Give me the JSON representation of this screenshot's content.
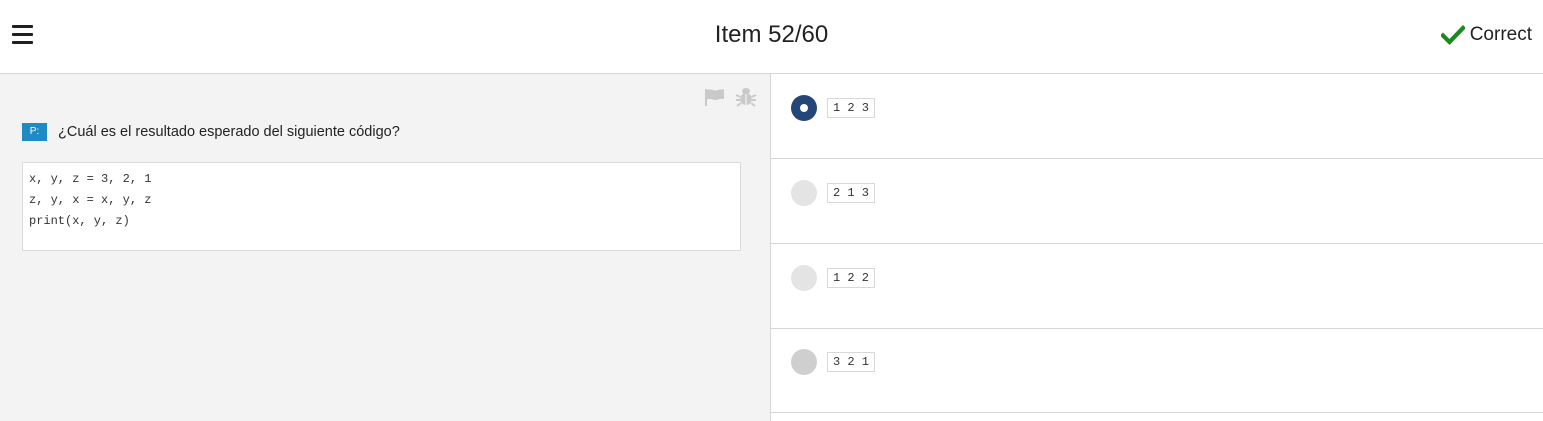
{
  "header": {
    "title": "Item 52/60",
    "status_label": "Correct",
    "status_color": "#1a8a1a"
  },
  "toolbar": {
    "flag_icon": "flag-icon",
    "bug_icon": "bug-icon"
  },
  "question": {
    "badge": "P:",
    "text": "¿Cuál es el resultado esperado del siguiente código?",
    "code_lines": [
      "x, y, z = 3, 2, 1",
      "z, y, x = x, y, z",
      "print(x, y, z)"
    ]
  },
  "options": [
    {
      "code": "1 2 3",
      "selected": true
    },
    {
      "code": "2 1 3",
      "selected": false
    },
    {
      "code": "1 2 2",
      "selected": false
    },
    {
      "code": "3 2 1",
      "selected": false
    }
  ],
  "colors": {
    "accent": "#254679",
    "badge": "#1e8bc3",
    "correct": "#1a8a1a"
  }
}
